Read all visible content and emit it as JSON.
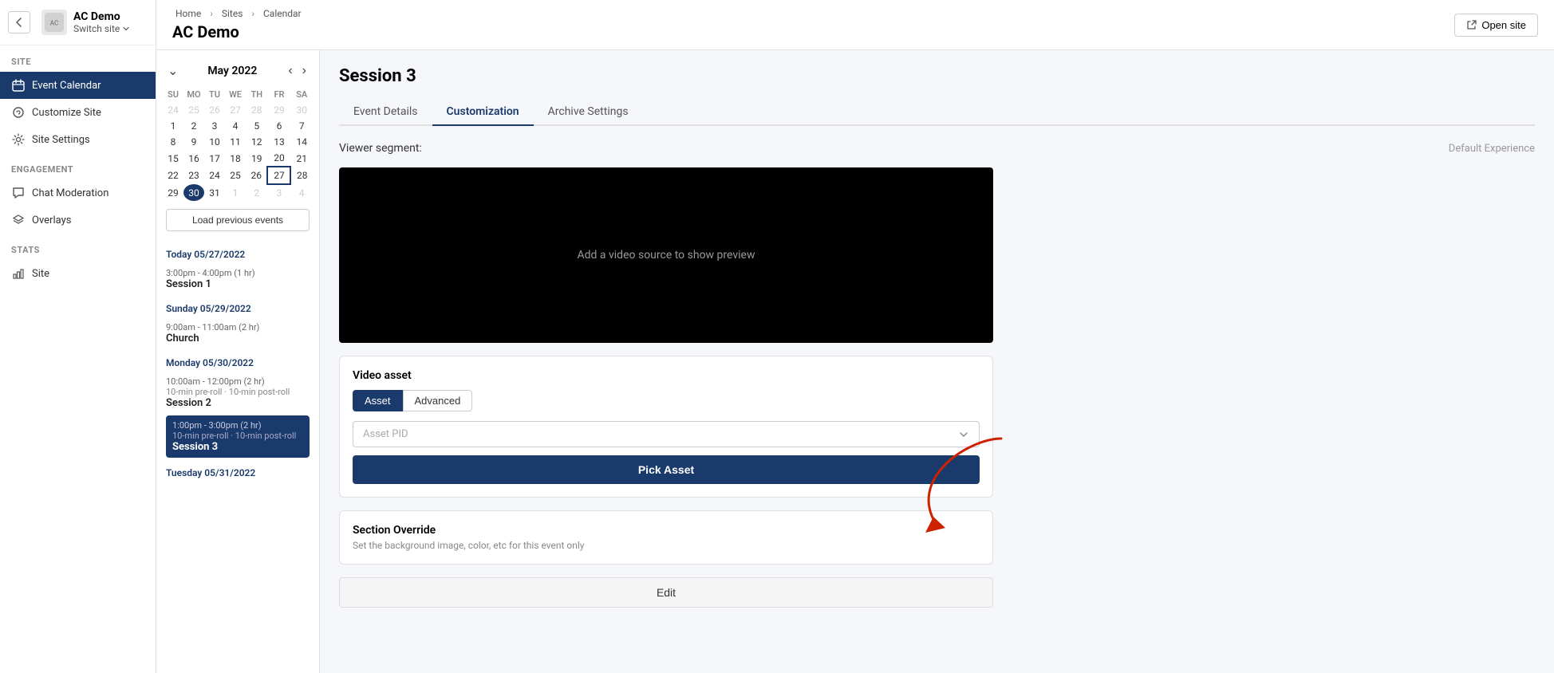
{
  "sidebar": {
    "back_icon": "←",
    "logo_text": "AC",
    "site_name": "AC Demo",
    "switch_label": "Switch site",
    "sections": [
      {
        "label": "SITE",
        "items": [
          {
            "id": "event-calendar",
            "label": "Event Calendar",
            "icon": "calendar",
            "active": true
          },
          {
            "id": "customize-site",
            "label": "Customize Site",
            "icon": "brush",
            "active": false
          },
          {
            "id": "site-settings",
            "label": "Site Settings",
            "icon": "gear",
            "active": false
          }
        ]
      },
      {
        "label": "ENGAGEMENT",
        "items": [
          {
            "id": "chat-moderation",
            "label": "Chat Moderation",
            "icon": "chat",
            "active": false
          },
          {
            "id": "overlays",
            "label": "Overlays",
            "icon": "layers",
            "active": false
          }
        ]
      },
      {
        "label": "STATS",
        "items": [
          {
            "id": "site-stats",
            "label": "Site",
            "icon": "chart",
            "active": false
          }
        ]
      }
    ]
  },
  "topbar": {
    "breadcrumb": "Home > Sites > Calendar",
    "breadcrumb_home": "Home",
    "breadcrumb_sites": "Sites",
    "breadcrumb_calendar": "Calendar",
    "page_title": "AC Demo",
    "open_site_label": "Open site"
  },
  "calendar": {
    "month_year": "May 2022",
    "days_of_week": [
      "SU",
      "MO",
      "TU",
      "WE",
      "TH",
      "FR",
      "SA"
    ],
    "weeks": [
      [
        {
          "d": "24",
          "other": true
        },
        {
          "d": "25",
          "other": true
        },
        {
          "d": "26",
          "other": true
        },
        {
          "d": "27",
          "other": true
        },
        {
          "d": "28",
          "other": true
        },
        {
          "d": "29",
          "other": true
        },
        {
          "d": "30",
          "other": true
        }
      ],
      [
        {
          "d": "1"
        },
        {
          "d": "2"
        },
        {
          "d": "3"
        },
        {
          "d": "4"
        },
        {
          "d": "5"
        },
        {
          "d": "6"
        },
        {
          "d": "7"
        }
      ],
      [
        {
          "d": "8"
        },
        {
          "d": "9"
        },
        {
          "d": "10"
        },
        {
          "d": "11"
        },
        {
          "d": "12"
        },
        {
          "d": "13"
        },
        {
          "d": "14"
        }
      ],
      [
        {
          "d": "15"
        },
        {
          "d": "16"
        },
        {
          "d": "17"
        },
        {
          "d": "18"
        },
        {
          "d": "19"
        },
        {
          "d": "20"
        },
        {
          "d": "21"
        }
      ],
      [
        {
          "d": "22"
        },
        {
          "d": "23"
        },
        {
          "d": "24"
        },
        {
          "d": "25"
        },
        {
          "d": "26"
        },
        {
          "d": "27",
          "highlighted": true
        },
        {
          "d": "28"
        }
      ],
      [
        {
          "d": "29"
        },
        {
          "d": "30",
          "selected": true
        },
        {
          "d": "31"
        },
        {
          "d": "1",
          "other": true
        },
        {
          "d": "2",
          "other": true
        },
        {
          "d": "3",
          "other": true
        },
        {
          "d": "4",
          "other": true
        }
      ]
    ],
    "load_prev_label": "Load previous events",
    "events": [
      {
        "day_label": "Today 05/27/2022",
        "items": [
          {
            "time": "3:00pm - 4:00pm (1 hr)",
            "name": "Session 1",
            "sub": "",
            "card": false
          }
        ]
      },
      {
        "day_label": "Sunday 05/29/2022",
        "items": [
          {
            "time": "9:00am - 11:00am (2 hr)",
            "name": "Church",
            "sub": "",
            "card": false
          }
        ]
      },
      {
        "day_label": "Monday 05/30/2022",
        "items": [
          {
            "time": "10:00am - 12:00pm (2 hr)",
            "name": "Session 2",
            "sub": "10-min pre-roll · 10-min post-roll",
            "card": false
          },
          {
            "time": "1:00pm - 3:00pm (2 hr)",
            "name": "Session 3",
            "sub": "10-min pre-roll · 10-min post-roll",
            "card": true
          }
        ]
      },
      {
        "day_label": "Tuesday 05/31/2022",
        "items": []
      }
    ]
  },
  "session": {
    "title": "Session 3",
    "tabs": [
      {
        "id": "event-details",
        "label": "Event Details",
        "active": false
      },
      {
        "id": "customization",
        "label": "Customization",
        "active": true
      },
      {
        "id": "archive-settings",
        "label": "Archive Settings",
        "active": false
      }
    ],
    "viewer_segment_label": "Viewer segment:",
    "viewer_segment_value": "Default Experience",
    "video_preview_text": "Add a video source to show preview",
    "video_asset_label": "Video asset",
    "asset_tabs": [
      {
        "id": "asset",
        "label": "Asset",
        "active": true
      },
      {
        "id": "advanced",
        "label": "Advanced",
        "active": false
      }
    ],
    "asset_pid_placeholder": "Asset PID",
    "pick_asset_label": "Pick Asset",
    "section_override_title": "Section Override",
    "section_override_desc": "Set the background image, color, etc for this event only",
    "edit_label": "Edit"
  }
}
